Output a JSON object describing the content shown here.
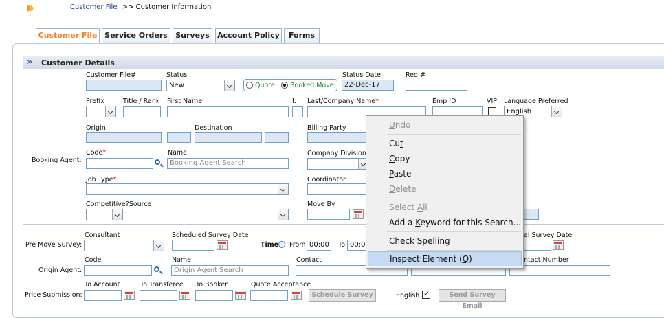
{
  "breadcrumb": {
    "link": "Customer File",
    "separator": ">>",
    "current": "Customer Information"
  },
  "tabs": [
    "Customer File",
    "Service Orders",
    "Surveys",
    "Account Policy",
    "Forms"
  ],
  "section_title": "Customer Details",
  "fields": {
    "customer_file_no": "Customer File#",
    "status": "Status",
    "status_value": "New",
    "quote": "Quote",
    "booked_move": "Booked Move",
    "status_date": "Status Date",
    "status_date_value": "22-Dec-17",
    "reg_no": "Reg #",
    "prefix": "Prefix",
    "title_rank": "Title / Rank",
    "first_name": "First Name",
    "initial": "I.",
    "last_company": "Last/Company Name",
    "emp_id": "Emp ID",
    "vip": "VIP",
    "language_preferred": "Language Preferred",
    "language_value": "English",
    "origin": "Origin",
    "destination": "Destination",
    "billing_party": "Billing Party",
    "booking_agent": "Booking Agent:",
    "code": "Code",
    "name": "Name",
    "booking_agent_search": "Booking Agent Search",
    "company_division": "Company Division",
    "job_type": "Job Type",
    "coordinator": "Coordinator",
    "competitive": "Competitive?",
    "source": "Source",
    "move_by": "Move By"
  },
  "survey": {
    "pre_move": "Pre Move Survey:",
    "consultant": "Consultant",
    "scheduled_survey_date": "Scheduled Survey Date",
    "time": "Time",
    "from": "From",
    "from_value": "00:00",
    "to": "To",
    "to_value": "00:00",
    "actual_survey_date": "al Survey Date"
  },
  "origin_agent": {
    "label": "Origin Agent:",
    "code": "Code",
    "name": "Name",
    "search": "Origin Agent Search",
    "contact": "Contact",
    "contact_number": "ntact Number"
  },
  "price": {
    "label": "Price Submission:",
    "to_account": "To Account",
    "to_transferee": "To Transferee",
    "to_booker": "To Booker",
    "quote_acceptance": "Quote Acceptance",
    "schedule_survey": "Schedule Survey",
    "english": "English",
    "send_survey_email": "Send Survey Email"
  },
  "context_menu": {
    "undo": {
      "pre": "",
      "key": "U",
      "post": "ndo"
    },
    "cut": {
      "pre": "Cu",
      "key": "t",
      "post": ""
    },
    "copy": {
      "pre": "",
      "key": "C",
      "post": "opy"
    },
    "paste": {
      "pre": "",
      "key": "P",
      "post": "aste"
    },
    "delete": {
      "pre": "",
      "key": "D",
      "post": "elete"
    },
    "select_all": {
      "pre": "Select ",
      "key": "A",
      "post": "ll"
    },
    "add_keyword": {
      "pre": "Add a ",
      "key": "K",
      "post": "eyword for this Search..."
    },
    "check_spelling": {
      "pre": "Check Spellin",
      "key": "g",
      "post": ""
    },
    "inspect": {
      "pre": "Inspect Element (",
      "key": "Q",
      "post": ")"
    }
  },
  "colors": {
    "tab_active": "#f2842b",
    "link": "#1a3f8f",
    "field_border": "#6fa2c7",
    "highlight": "#c6dbf3"
  }
}
